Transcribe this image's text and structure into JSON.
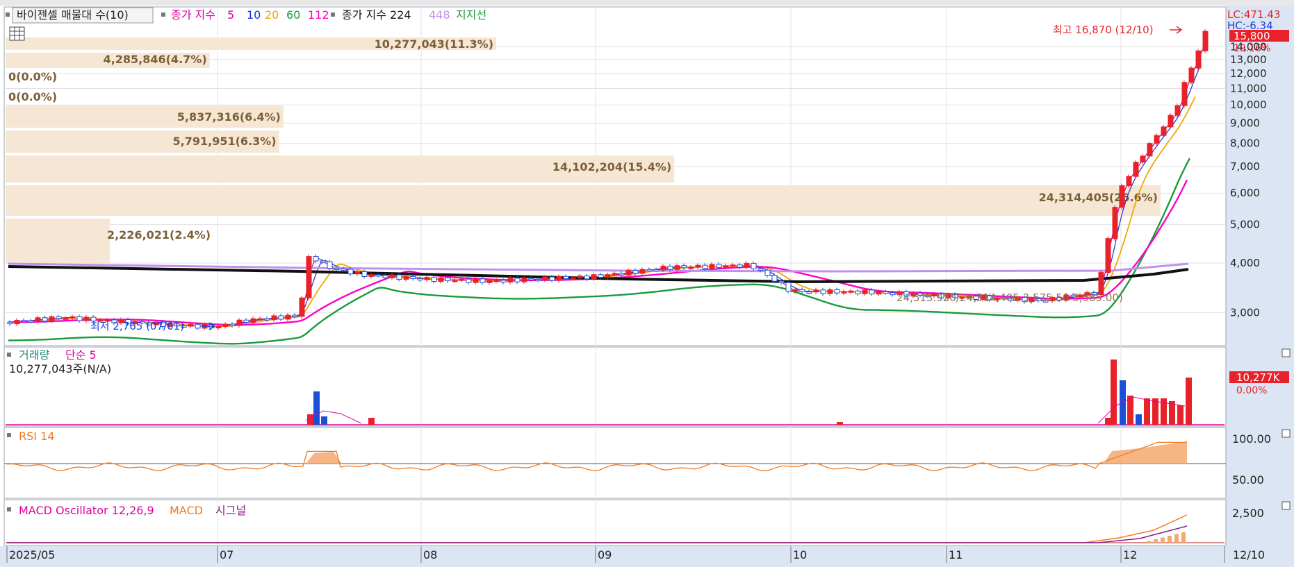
{
  "main_legend": {
    "title": "바이젠셀 매물대 수(10)",
    "ma_prefix": "종가 지수",
    "ma_periods": [
      "5",
      "10",
      "20",
      "60",
      "112"
    ],
    "ma_colors": [
      "#e000a0",
      "#1c2cd8",
      "#f0a800",
      "#1a9a3a",
      "#ff00c8"
    ],
    "long_label": "종가 지수 224",
    "p448": "448",
    "support": "지지선"
  },
  "main_price_labels": {
    "high": "최고 16,870 (12/10)",
    "low": "최저 2,765 (07/01)",
    "lc": "LC:471.43",
    "hc": "HC:-6.34",
    "current_price": "15,800",
    "current_change": "19.16%",
    "mid_overlay": "24,513.920/24,314,405  3,575.50  3,585.00)"
  },
  "volume_profile": [
    {
      "label": "2,226,021(2.4%)",
      "frac": 0.024
    },
    {
      "label": "24,314,405(26.6%)",
      "frac": 0.266
    },
    {
      "label": "14,102,204(15.4%)",
      "frac": 0.154
    },
    {
      "label": "5,791,951(6.3%)",
      "frac": 0.063
    },
    {
      "label": "5,837,316(6.4%)",
      "frac": 0.064
    },
    {
      "label": "0(0.0%)",
      "frac": 0.0
    },
    {
      "label": "0(0.0%)",
      "frac": 0.0
    },
    {
      "label": "4,285,846(4.7%)",
      "frac": 0.047
    },
    {
      "label": "10,277,043(11.3%)",
      "frac": 0.113
    }
  ],
  "volume_legend": {
    "label": "거래량",
    "ma": "단순 5",
    "value": "10,277,043주(N/A)",
    "badge": "10,277K",
    "badge_pct": "0.00%"
  },
  "rsi_legend": {
    "label": "RSI 14",
    "tick_100": "100.00",
    "tick_50": "50.00"
  },
  "macd_legend": {
    "label": "MACD Oscillator 12,26,9",
    "macd": "MACD",
    "signal": "시그널",
    "tick": "2,500"
  },
  "x_axis": [
    "2025/05",
    "07",
    "08",
    "09",
    "10",
    "11",
    "12",
    "12/10"
  ],
  "price_ticks": [
    "14,000",
    "13,000",
    "12,000",
    "11,000",
    "10,000",
    "9,000",
    "8,000",
    "7,000",
    "6,000",
    "5,000",
    "4,000",
    "3,000"
  ],
  "colors": {
    "up": "#e8222a",
    "down": "#1a4fd8",
    "profile": "#f6e6d4",
    "axis_bg": "#dbe5f3",
    "rsi": "#f07a22"
  },
  "chart_data": {
    "type": "candlestick",
    "title": "바이젠셀",
    "x_range": [
      "2025/05",
      "12/10"
    ],
    "y_scale": "log",
    "ylim": [
      2500,
      17500
    ],
    "candles": [
      {
        "x": "2025/05",
        "close": 2840
      },
      {
        "x": "2025/06",
        "close": 2900
      },
      {
        "x": "07",
        "close": 2765
      },
      {
        "x": "07-late",
        "close": 2920
      },
      {
        "x": "07-spike",
        "close": 4200
      },
      {
        "x": "08",
        "close": 3650
      },
      {
        "x": "09",
        "close": 3700
      },
      {
        "x": "09-late",
        "close": 3900
      },
      {
        "x": "10",
        "close": 3400
      },
      {
        "x": "11",
        "close": 3300
      },
      {
        "x": "11-late",
        "close": 3200
      },
      {
        "x": "12",
        "close": 6200
      },
      {
        "x": "12/05",
        "close": 9600
      },
      {
        "x": "12/08",
        "close": 13100
      },
      {
        "x": "12/10",
        "close": 15800
      }
    ],
    "high": {
      "value": 16870,
      "date": "12/10"
    },
    "low": {
      "value": 2765,
      "date": "07/01"
    },
    "rsi_range": [
      0,
      100
    ],
    "last_volume": 10277043
  }
}
